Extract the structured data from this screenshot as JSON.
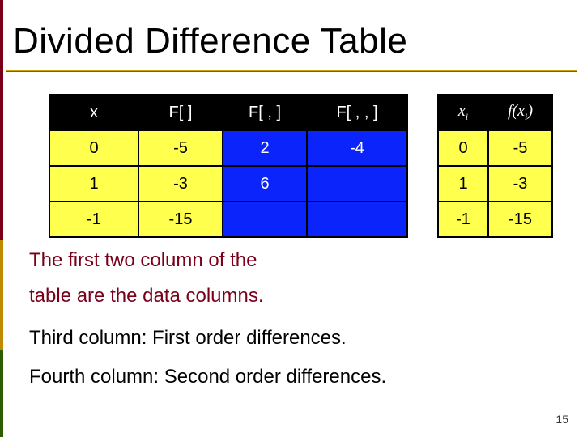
{
  "title": "Divided Difference Table",
  "left_table": {
    "headers": {
      "x": "x",
      "f0": "F[ ]",
      "f1": "F[  ,  ]",
      "f2": "F[  ,  ,  ]"
    },
    "rows": [
      {
        "x": "0",
        "f0": "-5",
        "f1": "2",
        "f2": "-4"
      },
      {
        "x": "1",
        "f0": "-3",
        "f1": "6",
        "f2": ""
      },
      {
        "x": "-1",
        "f0": "-15",
        "f1": "",
        "f2": ""
      }
    ]
  },
  "right_table": {
    "headers": {
      "xi_sym": "x",
      "xi_sub": "i",
      "fxi_pre": "f(x",
      "fxi_sub": "i",
      "fxi_post": ")"
    },
    "rows": [
      {
        "xi": "0",
        "fxi": "-5"
      },
      {
        "xi": "1",
        "fxi": "-3"
      },
      {
        "xi": "-1",
        "fxi": "-15"
      }
    ]
  },
  "body": {
    "l1": "The first two column of the",
    "l2": "table are the data columns.",
    "l3": "Third column:  First order differences.",
    "l4": "Fourth column: Second order differences."
  },
  "page_number": "15",
  "chart_data": {
    "type": "table",
    "title": "Divided Difference Table",
    "data_points": {
      "x": [
        0,
        1,
        -1
      ],
      "f(x)": [
        -5,
        -3,
        -15
      ]
    },
    "divided_differences": {
      "first_order": [
        2,
        6
      ],
      "second_order": [
        -4
      ]
    },
    "notes": [
      "The first two columns of the table are the data columns.",
      "Third column: First order differences.",
      "Fourth column: Second order differences."
    ]
  }
}
